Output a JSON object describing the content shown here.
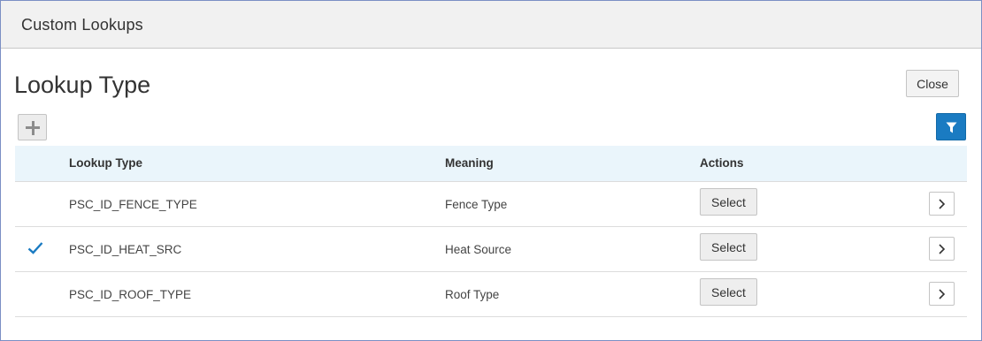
{
  "window": {
    "title": "Custom Lookups"
  },
  "page": {
    "heading": "Lookup Type",
    "close_label": "Close"
  },
  "toolbar": {
    "add_icon": "plus-icon",
    "filter_icon": "filter-icon"
  },
  "table": {
    "columns": {
      "lookup_type": "Lookup Type",
      "meaning": "Meaning",
      "actions": "Actions"
    },
    "rows": [
      {
        "lookup_type": "PSC_ID_FENCE_TYPE",
        "meaning": "Fence Type",
        "action_label": "Select",
        "selected": false
      },
      {
        "lookup_type": "PSC_ID_HEAT_SRC",
        "meaning": "Heat Source",
        "action_label": "Select",
        "selected": true
      },
      {
        "lookup_type": "PSC_ID_ROOF_TYPE",
        "meaning": "Roof Type",
        "action_label": "Select",
        "selected": false
      }
    ]
  },
  "colors": {
    "accent": "#1a7bc2",
    "header_bg": "#eaf5fb",
    "titlebar_bg": "#f1f1f1",
    "check": "#1a7bc2"
  }
}
